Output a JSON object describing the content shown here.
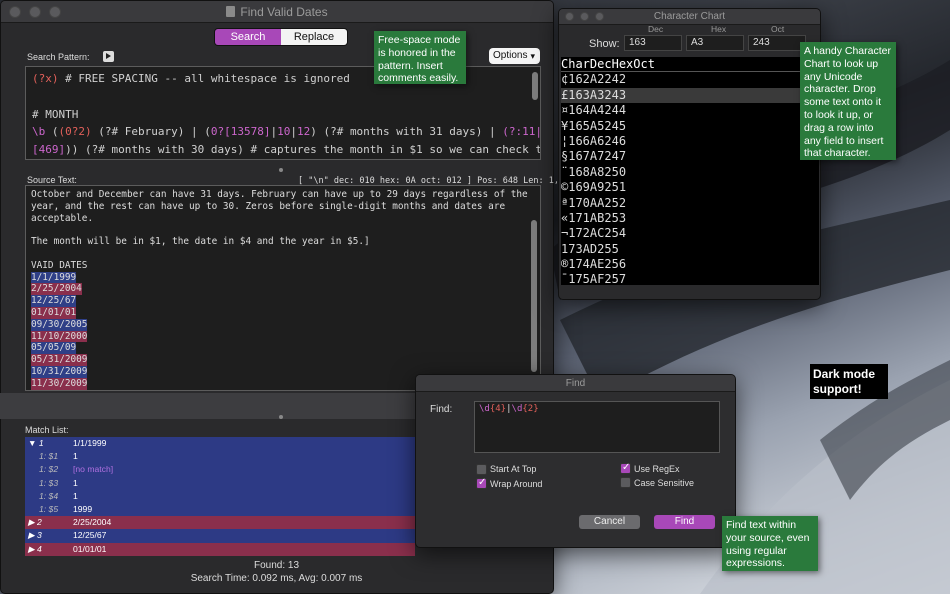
{
  "main_window": {
    "title": "Find Valid Dates",
    "mode_tabs": [
      "Search",
      "Replace"
    ],
    "active_tab": "Search",
    "search_pattern_label": "Search Pattern:",
    "options_label": "Options",
    "pattern_lines": [
      [
        {
          "t": "(?x)",
          "c": "red"
        },
        {
          "t": " # FREE SPACING -- all whitespace is ignored",
          "c": "plain"
        }
      ],
      [
        {
          "t": "",
          "c": "plain"
        }
      ],
      [
        {
          "t": "# MONTH",
          "c": "plain"
        }
      ],
      [
        {
          "t": "\\b",
          "c": "mag"
        },
        {
          "t": " (",
          "c": "plain"
        },
        {
          "t": "(0?2)",
          "c": "red"
        },
        {
          "t": " (?# February) | (",
          "c": "plain"
        },
        {
          "t": "0?[13578]",
          "c": "mag"
        },
        {
          "t": "|",
          "c": "plain"
        },
        {
          "t": "10",
          "c": "mag"
        },
        {
          "t": "|",
          "c": "plain"
        },
        {
          "t": "12",
          "c": "mag"
        },
        {
          "t": ") (?# months with 31 days) | ",
          "c": "plain"
        },
        {
          "t": "(?:11|0?",
          "c": "mag"
        }
      ],
      [
        {
          "t": "[469]",
          "c": "mag"
        },
        {
          "t": ")) (?# months with 30 days) # captures the month in $1 so we can check the",
          "c": "plain"
        }
      ],
      [
        {
          "t": "number of days against it in the next section",
          "c": "plain"
        }
      ]
    ],
    "source_label": "Source Text:",
    "status_line": "[ \"\\n\" dec: 010 hex: 0A oct: 012 ] Pos: 648 Len: 1,076",
    "source_lines": [
      {
        "t": "October and December can have 31 days. February can have up to 29 days regardless of the",
        "hl": ""
      },
      {
        "t": "year, and the rest can have up to 30. Zeros before single-digit months and dates are",
        "hl": ""
      },
      {
        "t": "acceptable.",
        "hl": ""
      },
      {
        "t": "",
        "hl": ""
      },
      {
        "t": "The month will be in $1, the date in $4 and the year in $5.]",
        "hl": ""
      },
      {
        "t": "",
        "hl": ""
      },
      {
        "t": "VAID DATES",
        "hl": ""
      },
      {
        "t": "1/1/1999",
        "hl": "blue"
      },
      {
        "t": "2/25/2004",
        "hl": "red"
      },
      {
        "t": "12/25/67",
        "hl": "blue"
      },
      {
        "t": "01/01/01",
        "hl": "red"
      },
      {
        "t": "09/30/2005",
        "hl": "blue"
      },
      {
        "t": "11/10/2000",
        "hl": "red"
      },
      {
        "t": "05/05/09",
        "hl": "blue"
      },
      {
        "t": "05/31/2009",
        "hl": "red"
      },
      {
        "t": "10/31/2009",
        "hl": "blue"
      },
      {
        "t": "11/30/2009",
        "hl": "red"
      }
    ],
    "match_list_label": "Match List:",
    "matches": [
      {
        "c1": "▼ 1",
        "c2": "1/1/1999",
        "kind": "group"
      },
      {
        "c1": "1: $1",
        "c2": "1",
        "kind": "sub"
      },
      {
        "c1": "1: $2",
        "c2": "[no match]",
        "kind": "sub",
        "nomatch": true
      },
      {
        "c1": "1: $3",
        "c2": "1",
        "kind": "sub"
      },
      {
        "c1": "1: $4",
        "c2": "1",
        "kind": "sub"
      },
      {
        "c1": "1: $5",
        "c2": "1999",
        "kind": "sub"
      },
      {
        "c1": "▶ 2",
        "c2": "2/25/2004",
        "kind": "red"
      },
      {
        "c1": "▶ 3",
        "c2": "12/25/67",
        "kind": "blue"
      },
      {
        "c1": "▶ 4",
        "c2": "01/01/01",
        "kind": "red"
      }
    ],
    "found": "Found: 13",
    "search_time": "Search Time: 0.092 ms, Avg: 0.007 ms"
  },
  "char_chart": {
    "title": "Character Chart",
    "col_dec": "Dec",
    "col_hex": "Hex",
    "col_oct": "Oct",
    "show_label": "Show:",
    "show_dec": "163",
    "show_hex": "A3",
    "show_oct": "243",
    "headers": [
      "Char",
      "Dec",
      "Hex",
      "Oct"
    ],
    "rows": [
      [
        "¢",
        "162",
        "A2",
        "242"
      ],
      [
        "£",
        "163",
        "A3",
        "243"
      ],
      [
        "¤",
        "164",
        "A4",
        "244"
      ],
      [
        "¥",
        "165",
        "A5",
        "245"
      ],
      [
        "¦",
        "166",
        "A6",
        "246"
      ],
      [
        "§",
        "167",
        "A7",
        "247"
      ],
      [
        "¨",
        "168",
        "A8",
        "250"
      ],
      [
        "©",
        "169",
        "A9",
        "251"
      ],
      [
        "ª",
        "170",
        "AA",
        "252"
      ],
      [
        "«",
        "171",
        "AB",
        "253"
      ],
      [
        "¬",
        "172",
        "AC",
        "254"
      ],
      [
        "",
        "173",
        "AD",
        "255"
      ],
      [
        "®",
        "174",
        "AE",
        "256"
      ],
      [
        "¯",
        "175",
        "AF",
        "257"
      ]
    ],
    "selected_row": 1
  },
  "find_panel": {
    "title": "Find",
    "find_label": "Find:",
    "query_parts": [
      {
        "t": "\\d",
        "c": "mag"
      },
      {
        "t": "{4}",
        "c": "red"
      },
      {
        "t": "|",
        "c": "plain"
      },
      {
        "t": "\\d",
        "c": "mag"
      },
      {
        "t": "{2}",
        "c": "red"
      }
    ],
    "start_at_top": "Start At Top",
    "wrap_around": "Wrap Around",
    "use_regex": "Use RegEx",
    "case_sensitive": "Case Sensitive",
    "cancel": "Cancel",
    "find": "Find",
    "checked": {
      "start_at_top": false,
      "wrap_around": true,
      "use_regex": true,
      "case_sensitive": false
    }
  },
  "callouts": {
    "free_space": "Free-space mode is honored in the pattern. Insert comments easily.",
    "char_chart": "A handy Character Chart to look up any Unicode character. Drop some text onto it to look it up, or drag a row into any field to insert that character.",
    "dark_mode": "Dark mode support!",
    "find_text": "Find text within your source, even using regular expressions."
  },
  "colors": {
    "accent": "#a848b8",
    "highlight_blue": "#2f3f87",
    "highlight_red": "#8a2f4c",
    "regex_red": "#e1605a",
    "regex_magenta": "#cc66cc",
    "callout_green": "#2a7a3c"
  }
}
